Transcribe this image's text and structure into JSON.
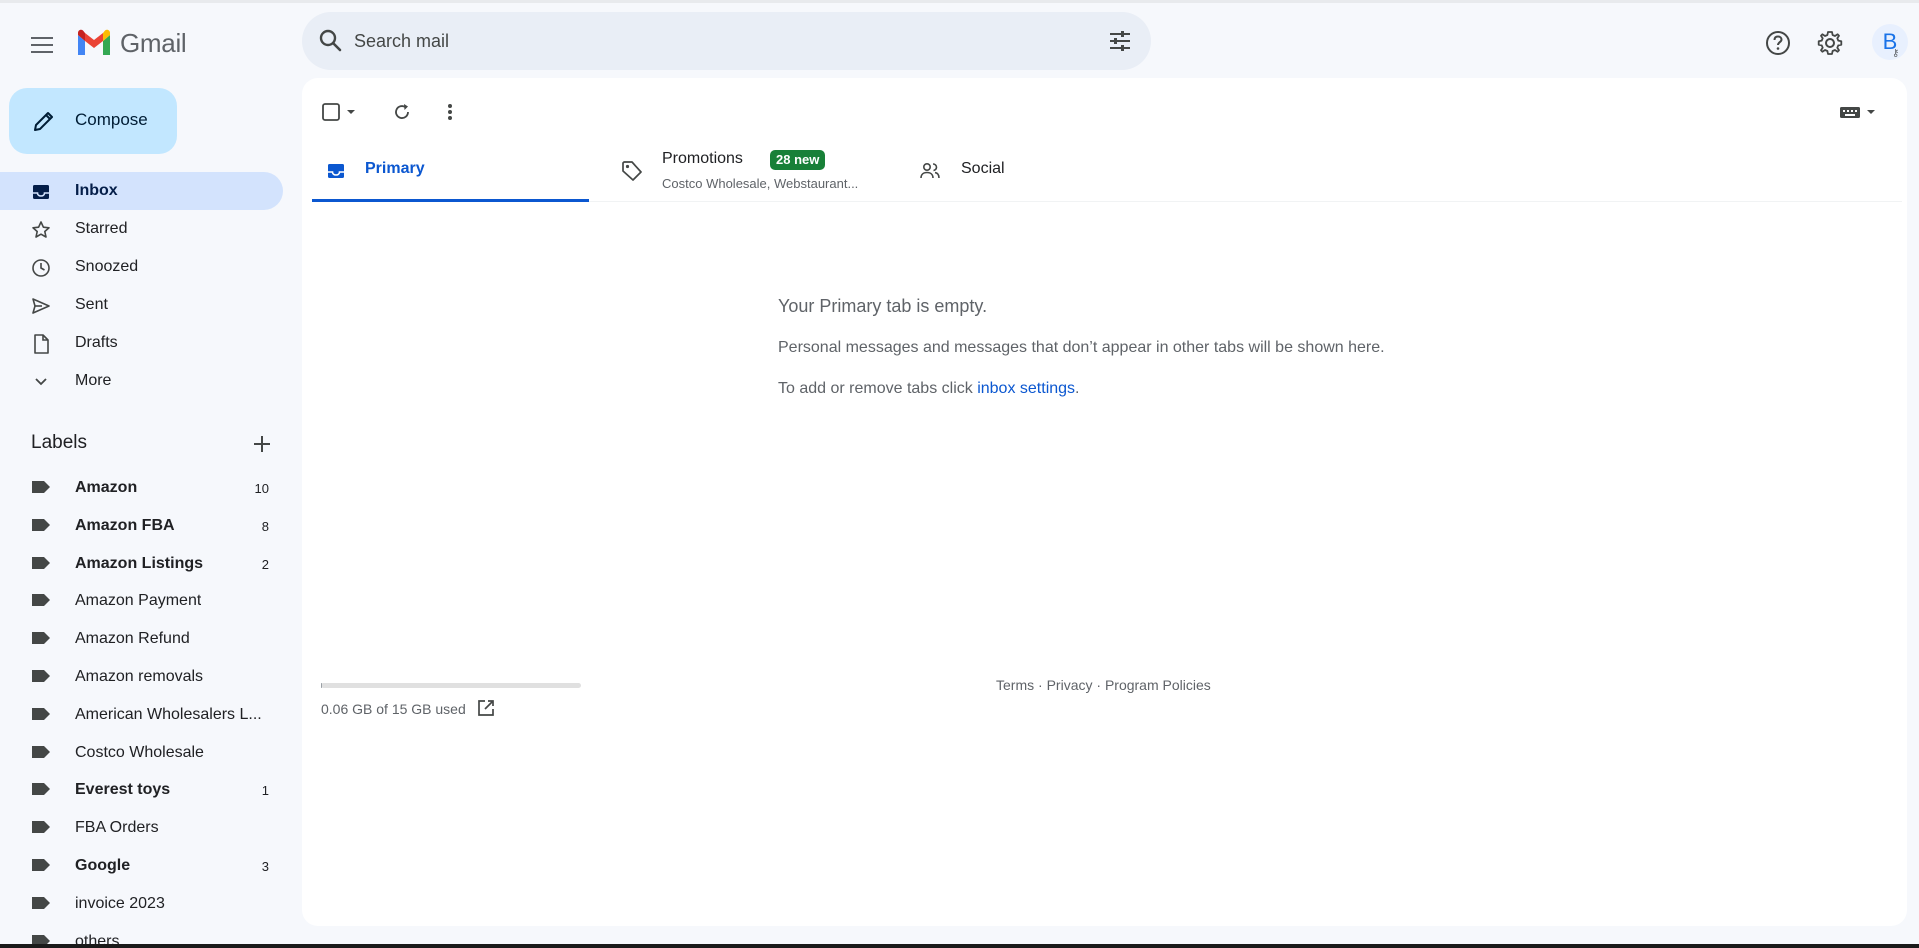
{
  "header": {
    "app_name": "Gmail",
    "search_placeholder": "Search mail",
    "avatar_letter": "B"
  },
  "sidebar": {
    "compose_label": "Compose",
    "nav": [
      {
        "label": "Inbox",
        "icon": "inbox-icon",
        "active": true
      },
      {
        "label": "Starred",
        "icon": "star-icon"
      },
      {
        "label": "Snoozed",
        "icon": "clock-icon"
      },
      {
        "label": "Sent",
        "icon": "send-icon"
      },
      {
        "label": "Drafts",
        "icon": "draft-icon"
      },
      {
        "label": "More",
        "icon": "chevron-down-icon"
      }
    ],
    "labels_title": "Labels",
    "labels": [
      {
        "name": "Amazon",
        "count": "10",
        "bold": true
      },
      {
        "name": "Amazon FBA",
        "count": "8",
        "bold": true
      },
      {
        "name": "Amazon Listings",
        "count": "2",
        "bold": true
      },
      {
        "name": "Amazon Payment",
        "count": "",
        "bold": false
      },
      {
        "name": "Amazon Refund",
        "count": "",
        "bold": false
      },
      {
        "name": "Amazon removals",
        "count": "",
        "bold": false
      },
      {
        "name": "American Wholesalers L...",
        "count": "",
        "bold": false
      },
      {
        "name": "Costco Wholesale",
        "count": "",
        "bold": false
      },
      {
        "name": "Everest toys",
        "count": "1",
        "bold": true
      },
      {
        "name": "FBA Orders",
        "count": "",
        "bold": false
      },
      {
        "name": "Google",
        "count": "3",
        "bold": true
      },
      {
        "name": "invoice 2023",
        "count": "",
        "bold": false
      },
      {
        "name": "others",
        "count": "",
        "bold": false
      }
    ]
  },
  "tabs": {
    "primary": "Primary",
    "promotions": "Promotions",
    "promotions_badge": "28 new",
    "promotions_sub": "Costco Wholesale, Webstaurant...",
    "social": "Social"
  },
  "empty": {
    "title": "Your Primary tab is empty.",
    "text": "Personal messages and messages that don’t appear in other tabs will be shown here.",
    "settings_prefix": "To add or remove tabs click ",
    "settings_link": "inbox settings",
    "settings_suffix": "."
  },
  "storage": {
    "text": "0.06 GB of 15 GB used",
    "fraction": 0.004
  },
  "footer": {
    "terms": "Terms",
    "privacy": "Privacy",
    "policies": "Program Policies",
    "sep": " · "
  },
  "colors": {
    "accent": "#0b57d0",
    "compose_bg": "#c2e7ff",
    "active_nav": "#d3e3fd",
    "badge": "#188038"
  }
}
